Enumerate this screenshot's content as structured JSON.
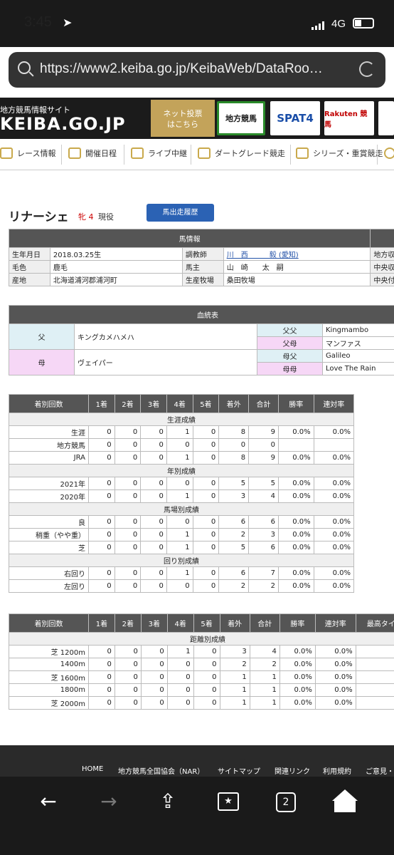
{
  "status_bar": {
    "time": "3:45",
    "network": "4G"
  },
  "browser": {
    "url": "https://www2.keiba.go.jp/KeibaWeb/DataRoo…"
  },
  "site": {
    "subtitle": "地方競馬情報サイト",
    "logo": "KEIBA.GO.JP",
    "net_button": "ネット投票\nはこちら",
    "banners": [
      "地方競馬",
      "SPAT4",
      "Rakuten 競馬"
    ]
  },
  "nav": [
    "レース情報",
    "開催日程",
    "ライブ中継",
    "ダートグレード競走",
    "シリーズ・重賞競走"
  ],
  "horse": {
    "name": "リナーシェ",
    "sex_age": "牝 4",
    "status": "現役",
    "history_button": "馬出走履歴"
  },
  "info": {
    "header": "馬情報",
    "rows": [
      {
        "l1": "生年月日",
        "v1": "2018.03.25生",
        "l2": "調教師",
        "v2": "川　西　　　毅 (愛知)",
        "l3": "地方収得"
      },
      {
        "l1": "毛色",
        "v1": "鹿毛",
        "l2": "馬主",
        "v2": "山　崎　　太　嗣",
        "l3": "中央収得"
      },
      {
        "l1": "産地",
        "v1": "北海道浦河郡浦河町",
        "l2": "生産牧場",
        "v2": "桑田牧場",
        "l3": "中央付加"
      }
    ]
  },
  "pedigree": {
    "header": "血統表",
    "sire_label": "父",
    "sire": "キングカメハメハ",
    "dam_label": "母",
    "dam": "ヴェイパー",
    "ff_label": "父父",
    "ff": "Kingmambo",
    "fm_label": "父母",
    "fm": "マンファス",
    "mf_label": "母父",
    "mf": "Galileo",
    "mm_label": "母母",
    "mm": "Love The Rain"
  },
  "results": {
    "headers": [
      "着別回数",
      "1着",
      "2着",
      "3着",
      "4着",
      "5着",
      "着外",
      "合計",
      "勝率",
      "連対率"
    ],
    "sections": [
      {
        "title": "生涯成績",
        "rows": [
          [
            "生涯",
            "0",
            "0",
            "0",
            "1",
            "0",
            "8",
            "9",
            "0.0%",
            "0.0%"
          ],
          [
            "地方競馬",
            "0",
            "0",
            "0",
            "0",
            "0",
            "0",
            "0",
            "",
            ""
          ],
          [
            "JRA",
            "0",
            "0",
            "0",
            "1",
            "0",
            "8",
            "9",
            "0.0%",
            "0.0%"
          ]
        ]
      },
      {
        "title": "年別成績",
        "rows": [
          [
            "2021年",
            "0",
            "0",
            "0",
            "0",
            "0",
            "5",
            "5",
            "0.0%",
            "0.0%"
          ],
          [
            "2020年",
            "0",
            "0",
            "0",
            "1",
            "0",
            "3",
            "4",
            "0.0%",
            "0.0%"
          ]
        ]
      },
      {
        "title": "馬場別成績",
        "rows": [
          [
            "良",
            "0",
            "0",
            "0",
            "0",
            "0",
            "6",
            "6",
            "0.0%",
            "0.0%"
          ],
          [
            "稍重（やや重）",
            "0",
            "0",
            "0",
            "1",
            "0",
            "2",
            "3",
            "0.0%",
            "0.0%"
          ],
          [
            "芝",
            "0",
            "0",
            "0",
            "1",
            "0",
            "5",
            "6",
            "0.0%",
            "0.0%"
          ]
        ]
      },
      {
        "title": "回り別成績",
        "rows": [
          [
            "右回り",
            "0",
            "0",
            "0",
            "1",
            "0",
            "6",
            "7",
            "0.0%",
            "0.0%"
          ],
          [
            "左回り",
            "0",
            "0",
            "0",
            "0",
            "0",
            "2",
            "2",
            "0.0%",
            "0.0%"
          ]
        ]
      }
    ]
  },
  "distance": {
    "headers": [
      "着別回数",
      "1着",
      "2着",
      "3着",
      "4着",
      "5着",
      "着外",
      "合計",
      "勝率",
      "連対率",
      "最高タイ"
    ],
    "title": "距離別成績",
    "rows": [
      [
        "芝 1200m",
        "0",
        "0",
        "0",
        "1",
        "0",
        "3",
        "4",
        "0.0%",
        "0.0%"
      ],
      [
        "1400m",
        "0",
        "0",
        "0",
        "0",
        "0",
        "2",
        "2",
        "0.0%",
        "0.0%"
      ],
      [
        "芝 1600m",
        "0",
        "0",
        "0",
        "0",
        "0",
        "1",
        "1",
        "0.0%",
        "0.0%"
      ],
      [
        "1800m",
        "0",
        "0",
        "0",
        "0",
        "0",
        "1",
        "1",
        "0.0%",
        "0.0%"
      ],
      [
        "芝 2000m",
        "0",
        "0",
        "0",
        "0",
        "0",
        "1",
        "1",
        "0.0%",
        "0.0%"
      ]
    ]
  },
  "footer": [
    "HOME",
    "地方競馬全国協会（NAR）",
    "サイトマップ",
    "関連リンク",
    "利用規約",
    "ご意見・"
  ],
  "toolbar": {
    "tabs_count": "2"
  }
}
